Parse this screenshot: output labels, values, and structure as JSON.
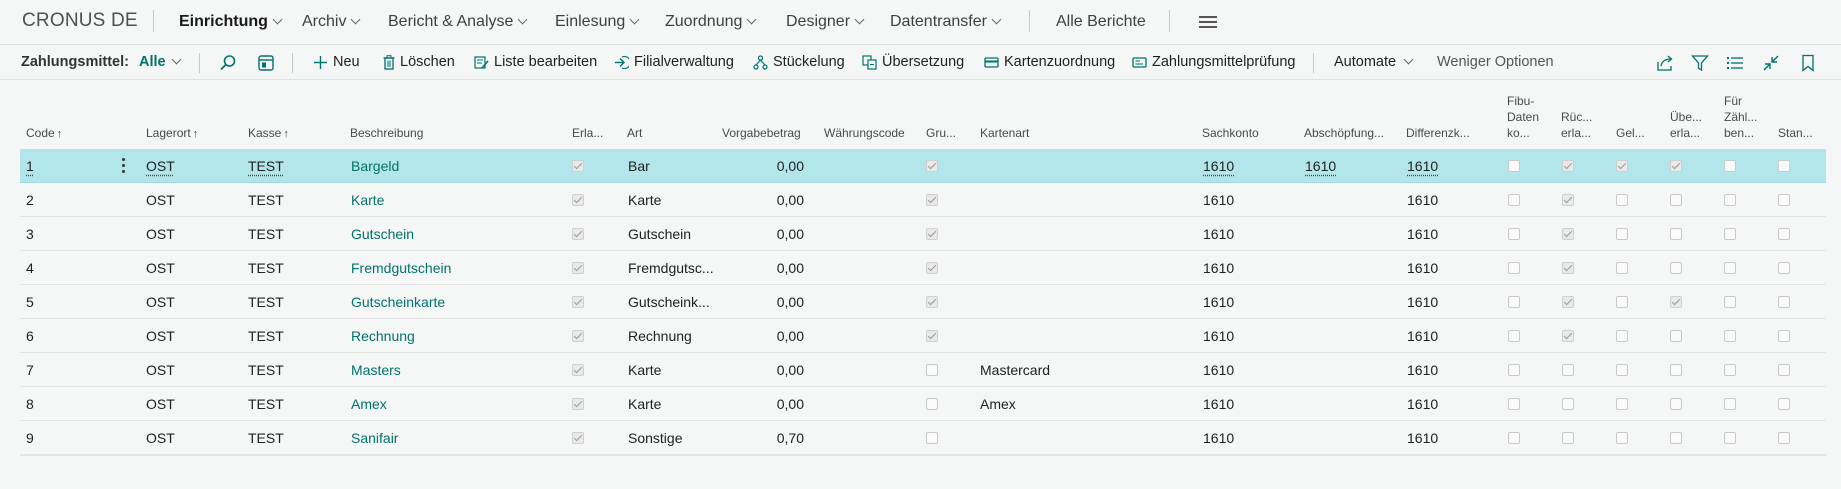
{
  "app": {
    "company": "CRONUS DE"
  },
  "nav": {
    "items": [
      {
        "label": "Einrichtung",
        "active": true
      },
      {
        "label": "Archiv"
      },
      {
        "label": "Bericht & Analyse"
      },
      {
        "label": "Einlesung"
      },
      {
        "label": "Zuordnung"
      },
      {
        "label": "Designer"
      },
      {
        "label": "Datentransfer"
      }
    ],
    "all_reports": "Alle Berichte"
  },
  "actions": {
    "filter_label": "Zahlungsmittel:",
    "filter_value": "Alle",
    "new": "Neu",
    "delete": "Löschen",
    "edit_list": "Liste bearbeiten",
    "branch_mgmt": "Filialverwaltung",
    "denomination": "Stückelung",
    "translation": "Übersetzung",
    "card_mapping": "Kartenzuordnung",
    "tender_check": "Zahlungsmittelprüfung",
    "automate": "Automate",
    "fewer_options": "Weniger Optionen"
  },
  "table": {
    "headers": {
      "code": "Code",
      "lagerort": "Lagerort",
      "kasse": "Kasse",
      "beschreibung": "Beschreibung",
      "erla": "Erla...",
      "art": "Art",
      "vorgabe": "Vorgabebetrag",
      "waehrung": "Währungscode",
      "gru": "Gru...",
      "kartenart": "Kartenart",
      "sachkonto": "Sachkonto",
      "abschoepf": "Abschöpfung...",
      "differenz": "Differenzk...",
      "fibu": [
        "Fibu-",
        "Daten",
        "ko..."
      ],
      "rueck": [
        "Rüc...",
        "erla..."
      ],
      "gel": "Gel...",
      "ueber": [
        "Übe...",
        "erla..."
      ],
      "fuer": [
        "Für",
        "Zähl...",
        "ben..."
      ],
      "stan": "Stan..."
    },
    "rows": [
      {
        "code": "1",
        "lagerort": "OST",
        "kasse": "TEST",
        "beschreibung": "Bargeld",
        "art": "Bar",
        "vorgabe": "0,00",
        "kartenart": "",
        "sachkonto": "1610",
        "abschoepf": "1610",
        "differenz": "1610",
        "erla": true,
        "gru": true,
        "fibu": false,
        "rueck": true,
        "gel": true,
        "ueber": true,
        "fuer": false,
        "stan": false
      },
      {
        "code": "2",
        "lagerort": "OST",
        "kasse": "TEST",
        "beschreibung": "Karte",
        "art": "Karte",
        "vorgabe": "0,00",
        "kartenart": "",
        "sachkonto": "1610",
        "abschoepf": "",
        "differenz": "1610",
        "erla": true,
        "gru": true,
        "fibu": false,
        "rueck": true,
        "gel": false,
        "ueber": false,
        "fuer": false,
        "stan": false
      },
      {
        "code": "3",
        "lagerort": "OST",
        "kasse": "TEST",
        "beschreibung": "Gutschein",
        "art": "Gutschein",
        "vorgabe": "0,00",
        "kartenart": "",
        "sachkonto": "1610",
        "abschoepf": "",
        "differenz": "1610",
        "erla": true,
        "gru": true,
        "fibu": false,
        "rueck": true,
        "gel": false,
        "ueber": false,
        "fuer": false,
        "stan": false
      },
      {
        "code": "4",
        "lagerort": "OST",
        "kasse": "TEST",
        "beschreibung": "Fremdgutschein",
        "art": "Fremdgutsc...",
        "vorgabe": "0,00",
        "kartenart": "",
        "sachkonto": "1610",
        "abschoepf": "",
        "differenz": "1610",
        "erla": true,
        "gru": true,
        "fibu": false,
        "rueck": true,
        "gel": false,
        "ueber": false,
        "fuer": false,
        "stan": false
      },
      {
        "code": "5",
        "lagerort": "OST",
        "kasse": "TEST",
        "beschreibung": "Gutscheinkarte",
        "art": "Gutscheink...",
        "vorgabe": "0,00",
        "kartenart": "",
        "sachkonto": "1610",
        "abschoepf": "",
        "differenz": "1610",
        "erla": true,
        "gru": true,
        "fibu": false,
        "rueck": true,
        "gel": false,
        "ueber": true,
        "fuer": false,
        "stan": false
      },
      {
        "code": "6",
        "lagerort": "OST",
        "kasse": "TEST",
        "beschreibung": "Rechnung",
        "art": "Rechnung",
        "vorgabe": "0,00",
        "kartenart": "",
        "sachkonto": "1610",
        "abschoepf": "",
        "differenz": "1610",
        "erla": true,
        "gru": true,
        "fibu": false,
        "rueck": true,
        "gel": false,
        "ueber": false,
        "fuer": false,
        "stan": false
      },
      {
        "code": "7",
        "lagerort": "OST",
        "kasse": "TEST",
        "beschreibung": "Masters",
        "art": "Karte",
        "vorgabe": "0,00",
        "kartenart": "Mastercard",
        "sachkonto": "1610",
        "abschoepf": "",
        "differenz": "1610",
        "erla": true,
        "gru": false,
        "fibu": false,
        "rueck": false,
        "gel": false,
        "ueber": false,
        "fuer": false,
        "stan": false
      },
      {
        "code": "8",
        "lagerort": "OST",
        "kasse": "TEST",
        "beschreibung": "Amex",
        "art": "Karte",
        "vorgabe": "0,00",
        "kartenart": "Amex",
        "sachkonto": "1610",
        "abschoepf": "",
        "differenz": "1610",
        "erla": true,
        "gru": false,
        "fibu": false,
        "rueck": false,
        "gel": false,
        "ueber": false,
        "fuer": false,
        "stan": false
      },
      {
        "code": "9",
        "lagerort": "OST",
        "kasse": "TEST",
        "beschreibung": "Sanifair",
        "art": "Sonstige",
        "vorgabe": "0,70",
        "kartenart": "",
        "sachkonto": "1610",
        "abschoepf": "",
        "differenz": "1610",
        "erla": true,
        "gru": false,
        "fibu": false,
        "rueck": false,
        "gel": false,
        "ueber": false,
        "fuer": false,
        "stan": false
      }
    ]
  }
}
